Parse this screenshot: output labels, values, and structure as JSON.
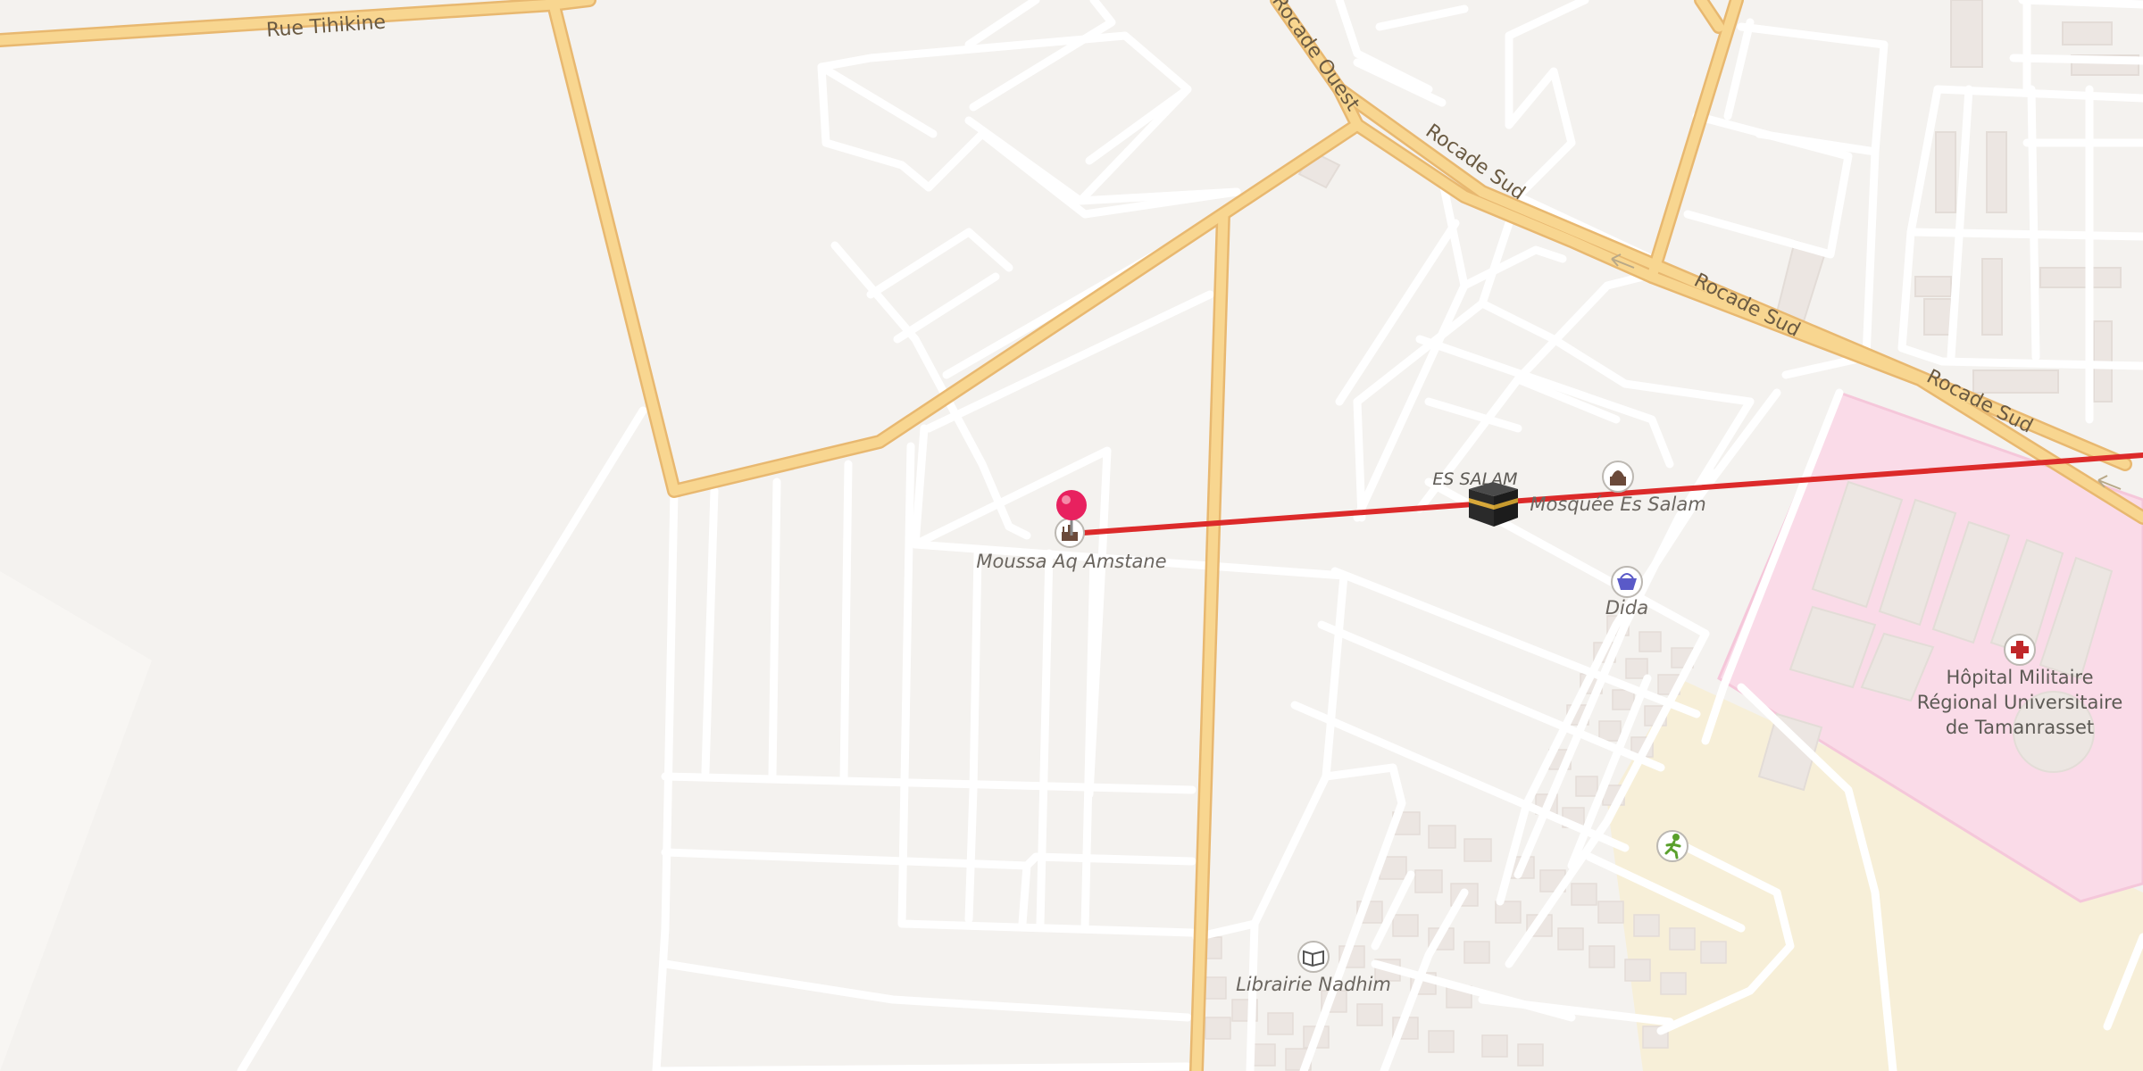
{
  "map": {
    "streets": {
      "rue_tihikine": "Rue Tihikine",
      "rocade_ouest": "Rocade Ouest",
      "rocade_sud_1": "Rocade Sud",
      "rocade_sud_2": "Rocade Sud",
      "rocade_sud_3": "Rocade Sud"
    },
    "places": {
      "moussa_label": "Moussa Aq Amstane",
      "es_salam_label": "ES SALAM",
      "mosque_label": "Mosquée Es Salam",
      "dida_label": "Dida",
      "hospital_line1": "Hôpital Militaire",
      "hospital_line2": "Régional Universitaire",
      "hospital_line3": "de Tamanrasset",
      "librairie_label": "Librairie Nadhim"
    },
    "icons": {
      "pin": "location-pin-icon",
      "mosque_poi": "mosque-icon",
      "kaaba": "kaaba-icon",
      "shop": "shopping-basket-icon",
      "hospital": "hospital-cross-icon",
      "sport": "running-person-icon",
      "book": "book-icon"
    },
    "colors": {
      "background": "#f4f2ef",
      "major_road": "#f8d690",
      "major_road_casing": "#e8b870",
      "minor_road": "#ffffff",
      "hospital_area": "#fadbe8",
      "sand_area": "#f7efd8",
      "route_line": "#dc2a2a",
      "pin": "#e8215f"
    }
  }
}
